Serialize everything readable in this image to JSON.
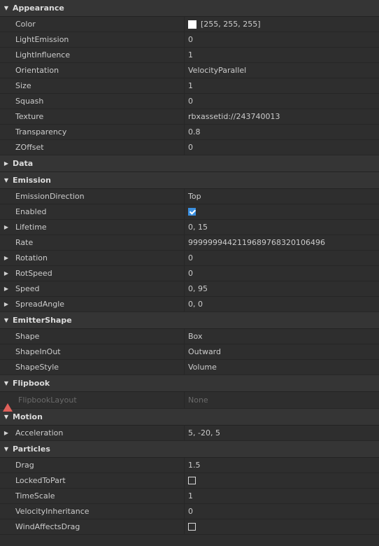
{
  "sections": {
    "appearance": {
      "title": "Appearance",
      "color": {
        "label": "Color",
        "value": "[255, 255, 255]",
        "swatch": "#ffffff"
      },
      "light_emission": {
        "label": "LightEmission",
        "value": "0"
      },
      "light_influence": {
        "label": "LightInfluence",
        "value": "1"
      },
      "orientation": {
        "label": "Orientation",
        "value": "VelocityParallel"
      },
      "size": {
        "label": "Size",
        "value": "1"
      },
      "squash": {
        "label": "Squash",
        "value": "0"
      },
      "texture": {
        "label": "Texture",
        "value": "rbxassetid://243740013"
      },
      "transparency": {
        "label": "Transparency",
        "value": "0.8"
      },
      "zoffset": {
        "label": "ZOffset",
        "value": "0"
      }
    },
    "data": {
      "title": "Data"
    },
    "emission": {
      "title": "Emission",
      "emission_direction": {
        "label": "EmissionDirection",
        "value": "Top"
      },
      "enabled": {
        "label": "Enabled",
        "checked": true
      },
      "lifetime": {
        "label": "Lifetime",
        "value": "0, 15"
      },
      "rate": {
        "label": "Rate",
        "value": "9999999442119689768320106496"
      },
      "rotation": {
        "label": "Rotation",
        "value": "0"
      },
      "rot_speed": {
        "label": "RotSpeed",
        "value": "0"
      },
      "speed": {
        "label": "Speed",
        "value": "0, 95"
      },
      "spread_angle": {
        "label": "SpreadAngle",
        "value": "0, 0"
      }
    },
    "emitter_shape": {
      "title": "EmitterShape",
      "shape": {
        "label": "Shape",
        "value": "Box"
      },
      "shape_in_out": {
        "label": "ShapeInOut",
        "value": "Outward"
      },
      "shape_style": {
        "label": "ShapeStyle",
        "value": "Volume"
      }
    },
    "flipbook": {
      "title": "Flipbook",
      "flipbook_layout": {
        "label": "FlipbookLayout",
        "value": "None"
      }
    },
    "motion": {
      "title": "Motion",
      "acceleration": {
        "label": "Acceleration",
        "value": "5, -20, 5"
      }
    },
    "particles": {
      "title": "Particles",
      "drag": {
        "label": "Drag",
        "value": "1.5"
      },
      "locked_to_part": {
        "label": "LockedToPart",
        "checked": false
      },
      "time_scale": {
        "label": "TimeScale",
        "value": "1"
      },
      "velocity_inheritance": {
        "label": "VelocityInheritance",
        "value": "0"
      },
      "wind_affects_drag": {
        "label": "WindAffectsDrag",
        "checked": false
      }
    }
  },
  "colors": {
    "background": "#2e2e2e",
    "section_header": "#353535",
    "checkbox_checked": "#3a8fe0",
    "warning": "#e0605a"
  }
}
